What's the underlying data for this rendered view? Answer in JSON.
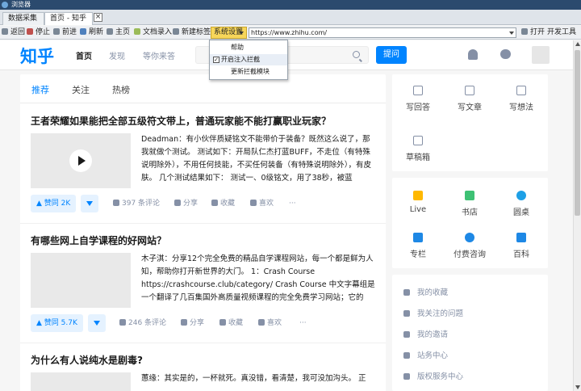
{
  "window": {
    "title": "浏览器"
  },
  "tabs": [
    {
      "label": "数据采集"
    },
    {
      "label": "首页 - 知乎 ..."
    }
  ],
  "toolbar": {
    "back": "返回",
    "stop": "停止",
    "forward": "前进",
    "refresh": "刷新",
    "home": "主页",
    "doc_inject": "文档录入",
    "new_tab": "新建标签",
    "system_settings": "系统设置",
    "url": "https://www.zhihu.com/",
    "open": "打开",
    "dev_tools": "开发工具"
  },
  "settings_menu": {
    "items": [
      {
        "label": "帮助",
        "checked": false
      },
      {
        "label": "开启注入拦截",
        "checked": true
      },
      {
        "label": "更新拦截模块",
        "checked": false
      }
    ]
  },
  "site": {
    "logo": "知乎",
    "nav": [
      "首页",
      "发现",
      "等你来答"
    ],
    "ask_label": "提问",
    "brand_color": "#0084ff"
  },
  "feed_tabs": [
    "推荐",
    "关注",
    "热榜"
  ],
  "cards": [
    {
      "title": "王者荣耀如果能把全部五级符文带上，普通玩家能不能打赢职业玩家？",
      "excerpt": "Deadman：有小伙伴质疑铭文不能带价于装备？既然这么说了，那我就做个测试。 测试如下：开局队仁杰打蓝BUFF，不走位（有特殊说明除外），不用任何技能，不买任何装备（有特殊说明除外），有皮肤。 几个测试结果如下： 测试一、0级铭文，用了38秒，被蓝",
      "vote": "▲ 赞同 2K",
      "comments": "397 条评论",
      "share": "分享",
      "collect": "收藏",
      "like": "喜欢",
      "more": "···"
    },
    {
      "title": "有哪些网上自学课程的好网站？",
      "excerpt": "木子淇：分享12个完全免费的精品自学课程网站，每一个都是鲜为人知，帮助你打开新世界的大门。 1：Crash Course https://crashcourse.club/category/ Crash Course 中文字幕组是一个翻译了几百集国外高质量视频课程的完全免费学习网站；它的",
      "vote": "▲ 赞同 5.7K",
      "comments": "246 条评论",
      "share": "分享",
      "collect": "收藏",
      "like": "喜欢",
      "more": "···"
    },
    {
      "title": "为什么有人说纯水是剧毒?",
      "excerpt": "蕙缘：其实是的，一杯就死。真没错，看清楚，我可没加沟头。 正"
    }
  ],
  "sidebar": {
    "create": [
      "写回答",
      "写文章",
      "写想法",
      "草稿箱"
    ],
    "features": [
      "Live",
      "书店",
      "圆桌",
      "专栏",
      "付费咨询",
      "百科"
    ],
    "links": [
      "我的收藏",
      "我关注的问题",
      "我的邀请",
      "站务中心",
      "版权服务中心"
    ]
  }
}
